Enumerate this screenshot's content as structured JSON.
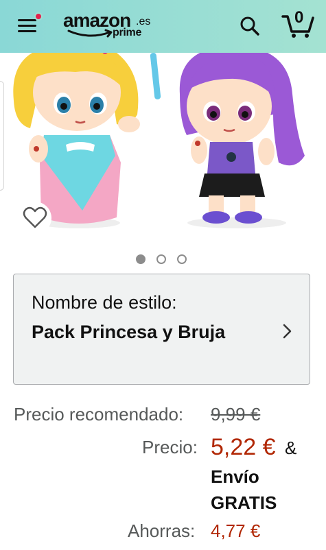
{
  "header": {
    "logo_word": "amazon",
    "logo_suffix": ".es",
    "logo_prime": "prime",
    "cart_count": "0"
  },
  "icons": {
    "menu": "hamburger-menu-icon",
    "notification": "notification-dot",
    "search": "search-icon",
    "cart": "cart-icon",
    "wishlist": "heart-icon",
    "chevron": "chevron-right-icon"
  },
  "carousel": {
    "total_images": 3,
    "active_index": 0
  },
  "style_selector": {
    "label": "Nombre de estilo:",
    "value": "Pack Princesa y Bruja"
  },
  "pricing": {
    "recommended_label": "Precio recomendado:",
    "recommended_value": "9,99 €",
    "price_label": "Precio:",
    "price_value": "5,22 €",
    "ampersand": "&",
    "shipping": "Envío GRATIS",
    "savings_label": "Ahorras:",
    "savings_value": "4,77 €"
  },
  "colors": {
    "header_bg": "#8ad8d6",
    "price_red": "#b12704",
    "notification_red": "#e3204d",
    "label_gray": "#565959"
  }
}
